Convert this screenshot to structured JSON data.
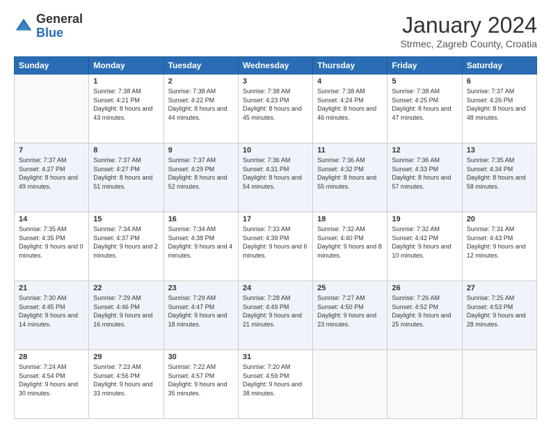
{
  "header": {
    "logo_general": "General",
    "logo_blue": "Blue",
    "month": "January 2024",
    "location": "Strmec, Zagreb County, Croatia"
  },
  "weekdays": [
    "Sunday",
    "Monday",
    "Tuesday",
    "Wednesday",
    "Thursday",
    "Friday",
    "Saturday"
  ],
  "weeks": [
    [
      {
        "day": "",
        "sunrise": "",
        "sunset": "",
        "daylight": ""
      },
      {
        "day": "1",
        "sunrise": "Sunrise: 7:38 AM",
        "sunset": "Sunset: 4:21 PM",
        "daylight": "Daylight: 8 hours and 43 minutes."
      },
      {
        "day": "2",
        "sunrise": "Sunrise: 7:38 AM",
        "sunset": "Sunset: 4:22 PM",
        "daylight": "Daylight: 8 hours and 44 minutes."
      },
      {
        "day": "3",
        "sunrise": "Sunrise: 7:38 AM",
        "sunset": "Sunset: 4:23 PM",
        "daylight": "Daylight: 8 hours and 45 minutes."
      },
      {
        "day": "4",
        "sunrise": "Sunrise: 7:38 AM",
        "sunset": "Sunset: 4:24 PM",
        "daylight": "Daylight: 8 hours and 46 minutes."
      },
      {
        "day": "5",
        "sunrise": "Sunrise: 7:38 AM",
        "sunset": "Sunset: 4:25 PM",
        "daylight": "Daylight: 8 hours and 47 minutes."
      },
      {
        "day": "6",
        "sunrise": "Sunrise: 7:37 AM",
        "sunset": "Sunset: 4:26 PM",
        "daylight": "Daylight: 8 hours and 48 minutes."
      }
    ],
    [
      {
        "day": "7",
        "sunrise": "Sunrise: 7:37 AM",
        "sunset": "Sunset: 4:27 PM",
        "daylight": "Daylight: 8 hours and 49 minutes."
      },
      {
        "day": "8",
        "sunrise": "Sunrise: 7:37 AM",
        "sunset": "Sunset: 4:27 PM",
        "daylight": "Daylight: 8 hours and 51 minutes."
      },
      {
        "day": "9",
        "sunrise": "Sunrise: 7:37 AM",
        "sunset": "Sunset: 4:29 PM",
        "daylight": "Daylight: 8 hours and 52 minutes."
      },
      {
        "day": "10",
        "sunrise": "Sunrise: 7:36 AM",
        "sunset": "Sunset: 4:31 PM",
        "daylight": "Daylight: 8 hours and 54 minutes."
      },
      {
        "day": "11",
        "sunrise": "Sunrise: 7:36 AM",
        "sunset": "Sunset: 4:32 PM",
        "daylight": "Daylight: 8 hours and 55 minutes."
      },
      {
        "day": "12",
        "sunrise": "Sunrise: 7:36 AM",
        "sunset": "Sunset: 4:33 PM",
        "daylight": "Daylight: 8 hours and 57 minutes."
      },
      {
        "day": "13",
        "sunrise": "Sunrise: 7:35 AM",
        "sunset": "Sunset: 4:34 PM",
        "daylight": "Daylight: 8 hours and 58 minutes."
      }
    ],
    [
      {
        "day": "14",
        "sunrise": "Sunrise: 7:35 AM",
        "sunset": "Sunset: 4:35 PM",
        "daylight": "Daylight: 9 hours and 0 minutes."
      },
      {
        "day": "15",
        "sunrise": "Sunrise: 7:34 AM",
        "sunset": "Sunset: 4:37 PM",
        "daylight": "Daylight: 9 hours and 2 minutes."
      },
      {
        "day": "16",
        "sunrise": "Sunrise: 7:34 AM",
        "sunset": "Sunset: 4:38 PM",
        "daylight": "Daylight: 9 hours and 4 minutes."
      },
      {
        "day": "17",
        "sunrise": "Sunrise: 7:33 AM",
        "sunset": "Sunset: 4:39 PM",
        "daylight": "Daylight: 9 hours and 6 minutes."
      },
      {
        "day": "18",
        "sunrise": "Sunrise: 7:32 AM",
        "sunset": "Sunset: 4:40 PM",
        "daylight": "Daylight: 9 hours and 8 minutes."
      },
      {
        "day": "19",
        "sunrise": "Sunrise: 7:32 AM",
        "sunset": "Sunset: 4:42 PM",
        "daylight": "Daylight: 9 hours and 10 minutes."
      },
      {
        "day": "20",
        "sunrise": "Sunrise: 7:31 AM",
        "sunset": "Sunset: 4:43 PM",
        "daylight": "Daylight: 9 hours and 12 minutes."
      }
    ],
    [
      {
        "day": "21",
        "sunrise": "Sunrise: 7:30 AM",
        "sunset": "Sunset: 4:45 PM",
        "daylight": "Daylight: 9 hours and 14 minutes."
      },
      {
        "day": "22",
        "sunrise": "Sunrise: 7:29 AM",
        "sunset": "Sunset: 4:46 PM",
        "daylight": "Daylight: 9 hours and 16 minutes."
      },
      {
        "day": "23",
        "sunrise": "Sunrise: 7:29 AM",
        "sunset": "Sunset: 4:47 PM",
        "daylight": "Daylight: 9 hours and 18 minutes."
      },
      {
        "day": "24",
        "sunrise": "Sunrise: 7:28 AM",
        "sunset": "Sunset: 4:49 PM",
        "daylight": "Daylight: 9 hours and 21 minutes."
      },
      {
        "day": "25",
        "sunrise": "Sunrise: 7:27 AM",
        "sunset": "Sunset: 4:50 PM",
        "daylight": "Daylight: 9 hours and 23 minutes."
      },
      {
        "day": "26",
        "sunrise": "Sunrise: 7:26 AM",
        "sunset": "Sunset: 4:52 PM",
        "daylight": "Daylight: 9 hours and 25 minutes."
      },
      {
        "day": "27",
        "sunrise": "Sunrise: 7:25 AM",
        "sunset": "Sunset: 4:53 PM",
        "daylight": "Daylight: 9 hours and 28 minutes."
      }
    ],
    [
      {
        "day": "28",
        "sunrise": "Sunrise: 7:24 AM",
        "sunset": "Sunset: 4:54 PM",
        "daylight": "Daylight: 9 hours and 30 minutes."
      },
      {
        "day": "29",
        "sunrise": "Sunrise: 7:23 AM",
        "sunset": "Sunset: 4:56 PM",
        "daylight": "Daylight: 9 hours and 33 minutes."
      },
      {
        "day": "30",
        "sunrise": "Sunrise: 7:22 AM",
        "sunset": "Sunset: 4:57 PM",
        "daylight": "Daylight: 9 hours and 35 minutes."
      },
      {
        "day": "31",
        "sunrise": "Sunrise: 7:20 AM",
        "sunset": "Sunset: 4:59 PM",
        "daylight": "Daylight: 9 hours and 38 minutes."
      },
      {
        "day": "",
        "sunrise": "",
        "sunset": "",
        "daylight": ""
      },
      {
        "day": "",
        "sunrise": "",
        "sunset": "",
        "daylight": ""
      },
      {
        "day": "",
        "sunrise": "",
        "sunset": "",
        "daylight": ""
      }
    ]
  ]
}
